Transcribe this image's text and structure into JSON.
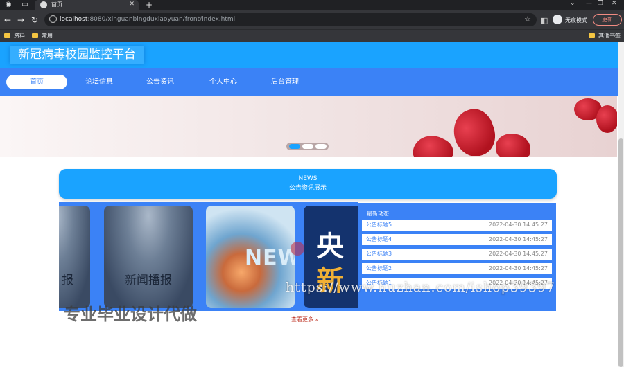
{
  "browser": {
    "tab_title": "首页",
    "url_host": "localhost",
    "url_rest": ":8080/xinguanbingduxiaoyuan/front/index.html",
    "incognito_label": "无痕模式",
    "update_label": "更新",
    "bookmarks": [
      "资料",
      "常用"
    ],
    "other_bookmarks": "其他书签"
  },
  "site": {
    "title": "新冠病毒校园监控平台",
    "nav": [
      "首页",
      "论坛信息",
      "公告资讯",
      "个人中心",
      "后台管理"
    ],
    "active_nav": "首页"
  },
  "news_section": {
    "title_en": "NEWS",
    "title_zh": "公告资讯展示"
  },
  "carousel": {
    "cards": [
      {
        "caption": "报"
      },
      {
        "caption": "新闻播报"
      },
      {
        "caption": "NEW"
      },
      {
        "caption_top": "央",
        "caption_bottom": "新"
      }
    ]
  },
  "latest": {
    "title": "最新动态",
    "items": [
      {
        "title": "公告标题5",
        "date": "2022-04-30 14:45:27"
      },
      {
        "title": "公告标题4",
        "date": "2022-04-30 14:45:27"
      },
      {
        "title": "公告标题3",
        "date": "2022-04-30 14:45:27"
      },
      {
        "title": "公告标题2",
        "date": "2022-04-30 14:45:27"
      },
      {
        "title": "公告标题1",
        "date": "2022-04-30 14:45:27"
      }
    ]
  },
  "more_label": "查看更多 »",
  "watermarks": {
    "url": "https://www.huzhan.com/ishop39397",
    "cn": "专业毕业设计代做"
  },
  "colors": {
    "header": "#1aa3ff",
    "nav": "#3b82f6",
    "accent": "#3b82f6"
  }
}
